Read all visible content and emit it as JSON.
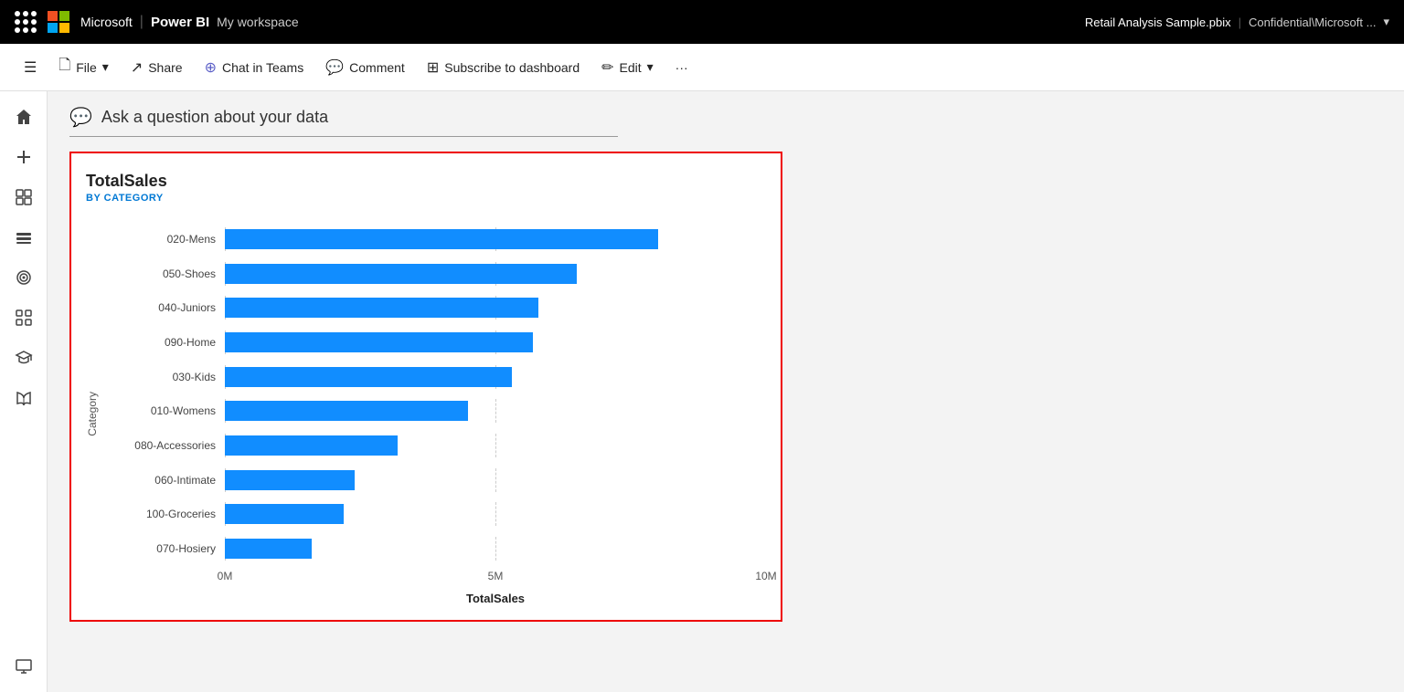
{
  "topbar": {
    "app_name": "Microsoft",
    "powerbi_label": "Power BI",
    "workspace_label": "My workspace",
    "file_name": "Retail Analysis Sample.pbix",
    "confidential_label": "Confidential\\Microsoft ...",
    "chevron": "▾"
  },
  "toolbar": {
    "hamburger_label": "☰",
    "file_label": "File",
    "share_label": "Share",
    "chat_in_teams_label": "Chat in Teams",
    "comment_label": "Comment",
    "subscribe_label": "Subscribe to dashboard",
    "edit_label": "Edit",
    "more_label": "···"
  },
  "sidebar": {
    "items": [
      {
        "name": "home",
        "icon": "⌂"
      },
      {
        "name": "create",
        "icon": "+"
      },
      {
        "name": "browse",
        "icon": "⊡"
      },
      {
        "name": "data-hub",
        "icon": "⬡"
      },
      {
        "name": "goals",
        "icon": "◎"
      },
      {
        "name": "apps",
        "icon": "⊞"
      },
      {
        "name": "learn",
        "icon": "🚀"
      },
      {
        "name": "open-book",
        "icon": "📖"
      },
      {
        "name": "monitor",
        "icon": "🖥"
      }
    ]
  },
  "qa_bar": {
    "placeholder": "Ask a question about your data"
  },
  "chart": {
    "title": "TotalSales",
    "subtitle": "BY CATEGORY",
    "y_axis_label": "Category",
    "x_axis_label": "TotalSales",
    "x_axis_ticks": [
      "0M",
      "5M",
      "10M"
    ],
    "max_value": 10000000,
    "bars": [
      {
        "label": "020-Mens",
        "value": 8000000
      },
      {
        "label": "050-Shoes",
        "value": 6500000
      },
      {
        "label": "040-Juniors",
        "value": 5800000
      },
      {
        "label": "090-Home",
        "value": 5700000
      },
      {
        "label": "030-Kids",
        "value": 5300000
      },
      {
        "label": "010-Womens",
        "value": 4500000
      },
      {
        "label": "080-Accessories",
        "value": 3200000
      },
      {
        "label": "060-Intimate",
        "value": 2400000
      },
      {
        "label": "100-Groceries",
        "value": 2200000
      },
      {
        "label": "070-Hosiery",
        "value": 1600000
      }
    ],
    "bar_color": "#118DFF"
  }
}
